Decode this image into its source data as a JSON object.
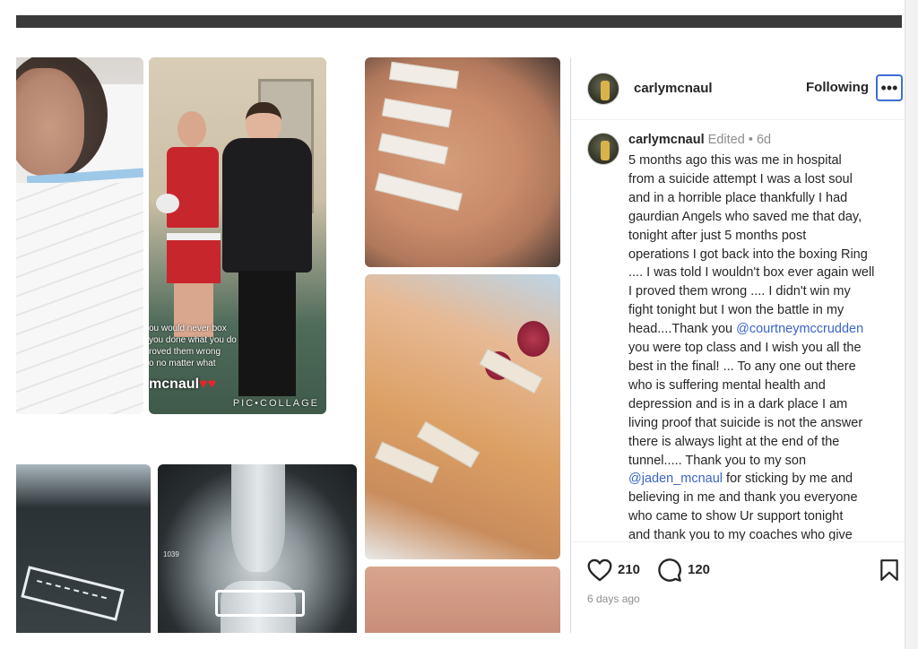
{
  "post": {
    "username": "carlymcnaul",
    "follow_label": "Following",
    "more_label": "•••",
    "caption": {
      "username": "carlymcnaul",
      "edited_label": "Edited",
      "separator": "•",
      "age": "6d",
      "lines": [
        "5 months ago this was me in hospital",
        "from a suicide attempt I was a lost soul",
        "and in a horrible place thankfully I had",
        "gaurdian Angels who saved me that day,",
        "tonight after just 5 months post",
        "operations I got back into the boxing Ring",
        ".... I was told I wouldn't box ever again well",
        "I proved them wrong .... I didn't win my",
        "fight tonight but I won the battle in my",
        "head....Thank you",
        "you were top class and I wish you all the",
        "best in the final! ... To any one out there",
        "who is suffering mental health and",
        "depression and is in a dark place I am",
        "living proof that suicide is not the answer",
        "there is always light at the end of the",
        "tunnel..... Thank you to my son",
        "for sticking by me and",
        "believing in me and thank you  everyone",
        "who came to show Ur  support tonight",
        "and thank you  to my coaches who give"
      ],
      "mention_1": "@courtneymccrudden",
      "mention_2": "@jaden_mcnaul"
    },
    "likes": "210",
    "comments": "120",
    "time_ago": "6 days ago"
  },
  "media": {
    "story_caption_lines": [
      "ou would never box",
      "you done what you do",
      "roved them wrong",
      "o no matter what"
    ],
    "story_name": "mcnaul",
    "watermark": "PIC•COLLAGE",
    "xray_marker": "1039"
  },
  "colors": {
    "mention": "#3b64c9",
    "more_button_border": "#3b6fd1",
    "topbar": "#3a3a3a"
  },
  "icons": {
    "like": "heart-icon",
    "comment": "comment-icon",
    "save": "bookmark-icon",
    "more": "ellipsis-icon"
  }
}
